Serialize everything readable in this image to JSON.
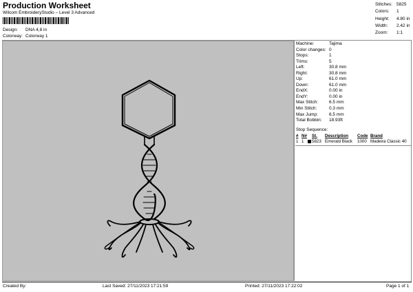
{
  "header": {
    "title": "Production Worksheet",
    "subtitle": "Wilcom EmbroideryStudio – Level 3 Advanced",
    "design_label": "Design:",
    "design_value": "DNA 4,8 in",
    "colorway_label": "Colorway:",
    "colorway_value": "Colorway 1"
  },
  "summary": [
    {
      "label": "Stitches:",
      "value": "5825"
    },
    {
      "label": "Colors:",
      "value": "1"
    },
    {
      "label": "Height:",
      "value": "4.80 in"
    },
    {
      "label": "Width:",
      "value": "2.42 in"
    },
    {
      "label": "Zoom:",
      "value": "1:1"
    }
  ],
  "properties": [
    {
      "label": "Machine:",
      "value": "Tajima"
    },
    {
      "label": "Color changes:",
      "value": "0"
    },
    {
      "label": "Stops:",
      "value": "1"
    },
    {
      "label": "Trims:",
      "value": "5"
    },
    {
      "label": "Left:",
      "value": "30.8 mm"
    },
    {
      "label": "Right:",
      "value": "30.8 mm"
    },
    {
      "label": "Up:",
      "value": "61.0 mm"
    },
    {
      "label": "Down:",
      "value": "61.0 mm"
    },
    {
      "label": "EndX:",
      "value": "0.00 in"
    },
    {
      "label": "EndY:",
      "value": "0.00 in"
    },
    {
      "label": "Max Stitch:",
      "value": "6.5 mm"
    },
    {
      "label": "Min Stitch:",
      "value": "0.3 mm"
    },
    {
      "label": "Max Jump:",
      "value": "6.5 mm"
    },
    {
      "label": "Total Bobbin:",
      "value": "18.93ft"
    }
  ],
  "stop_sequence": {
    "title": "Stop Sequence:",
    "headers": {
      "num": "#",
      "n": "N#",
      "st": "St.",
      "desc": "Description",
      "code": "Code",
      "brand": "Brand"
    },
    "rows": [
      {
        "num": "1",
        "n": "1",
        "st": "5823",
        "desc": "Emerald Black",
        "code": "1000",
        "brand": "Madeira Classic 40",
        "swatch": "#000000"
      }
    ]
  },
  "footer": {
    "created": "Created By:",
    "saved": "Last Saved: 27/11/2023 17:21:59",
    "printed": "Printed: 27/11/2023 17:22:02",
    "page": "Page 1 of 1"
  },
  "colors": {
    "canvas": "#c0c0c0",
    "thread": "#000000"
  },
  "icons": [
    "barcode",
    "color-swatch"
  ]
}
